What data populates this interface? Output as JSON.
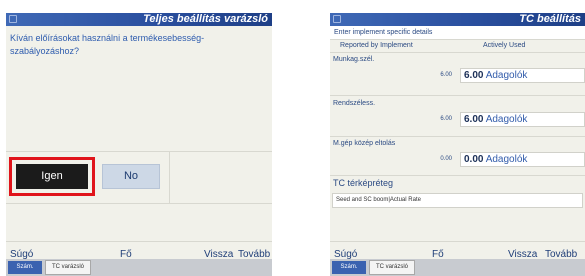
{
  "left_screen": {
    "title": "Teljes beállítás varázsló",
    "question": "Kíván előírásokat használni a termékesebesség-szabályozáshoz?",
    "yes_label": "Igen",
    "no_label": "No",
    "softkeys": [
      "Súgó",
      "Fő",
      "Vissza",
      "Tovább"
    ],
    "bottom_tab_active": "Szám.",
    "bottom_tab_name": "TC varázsló",
    "highlight_color": "#e0141b"
  },
  "right_screen": {
    "title": "TC beállítás",
    "subheader": "Enter implement specific details",
    "col_reported": "Reported by Implement",
    "col_active": "Actively Used",
    "rows": [
      {
        "label": "Munkag.szél.",
        "reported": "6.00",
        "active_value": "6.00",
        "active_unit": "Adagolók"
      },
      {
        "label": "Rendszéless.",
        "reported": "6.00",
        "active_value": "6.00",
        "active_unit": "Adagolók"
      },
      {
        "label": "M.gép közép eltolás",
        "reported": "0.00",
        "active_value": "0.00",
        "active_unit": "Adagolók"
      }
    ],
    "layer_label": "TC térképréteg",
    "layer_value": "Seed and SC boom|Actual Rate",
    "softkeys": [
      "Súgó",
      "Fő",
      "Vissza",
      "Tovább"
    ],
    "bottom_tab_active": "Szám.",
    "bottom_tab_name": "TC varázsló"
  }
}
